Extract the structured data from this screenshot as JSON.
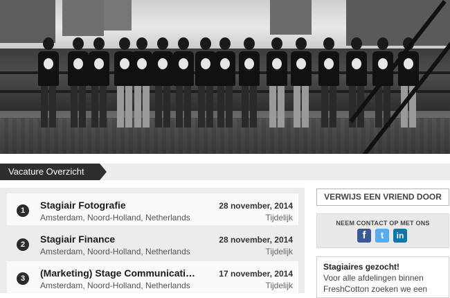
{
  "section": {
    "title": "Vacature Overzicht"
  },
  "jobs": [
    {
      "num": "1",
      "title": "Stagiair Fotografie",
      "location": "Amsterdam, Noord-Holland, Netherlands",
      "date": "28 november, 2014",
      "type": "Tijdelijk"
    },
    {
      "num": "2",
      "title": "Stagiair Finance",
      "location": "Amsterdam, Noord-Holland, Netherlands",
      "date": "28 november, 2014",
      "type": "Tijdelijk"
    },
    {
      "num": "3",
      "title": "(Marketing) Stage Communicati…",
      "location": "Amsterdam, Noord-Holland, Netherlands",
      "date": "17 november, 2014",
      "type": "Tijdelijk"
    }
  ],
  "sidebar": {
    "refer_button": "VERWIJS EEN VRIEND DOOR",
    "contact_label": "NEEM CONTACT OP MET ONS",
    "social": [
      {
        "icon": "facebook-icon",
        "glyph": "f"
      },
      {
        "icon": "twitter-icon",
        "glyph": "t"
      },
      {
        "icon": "linkedin-icon",
        "glyph": "in"
      }
    ],
    "promo_title": "Stagiaires gezocht!",
    "promo_body": "Voor alle afdelingen binnen FreshCotton zoeken we een"
  },
  "colors": {
    "tab_bg": "#2e2e2e",
    "number_badge": "#2b2b2b",
    "facebook": "#3b5998",
    "twitter": "#55acee",
    "linkedin": "#0e76a8"
  }
}
